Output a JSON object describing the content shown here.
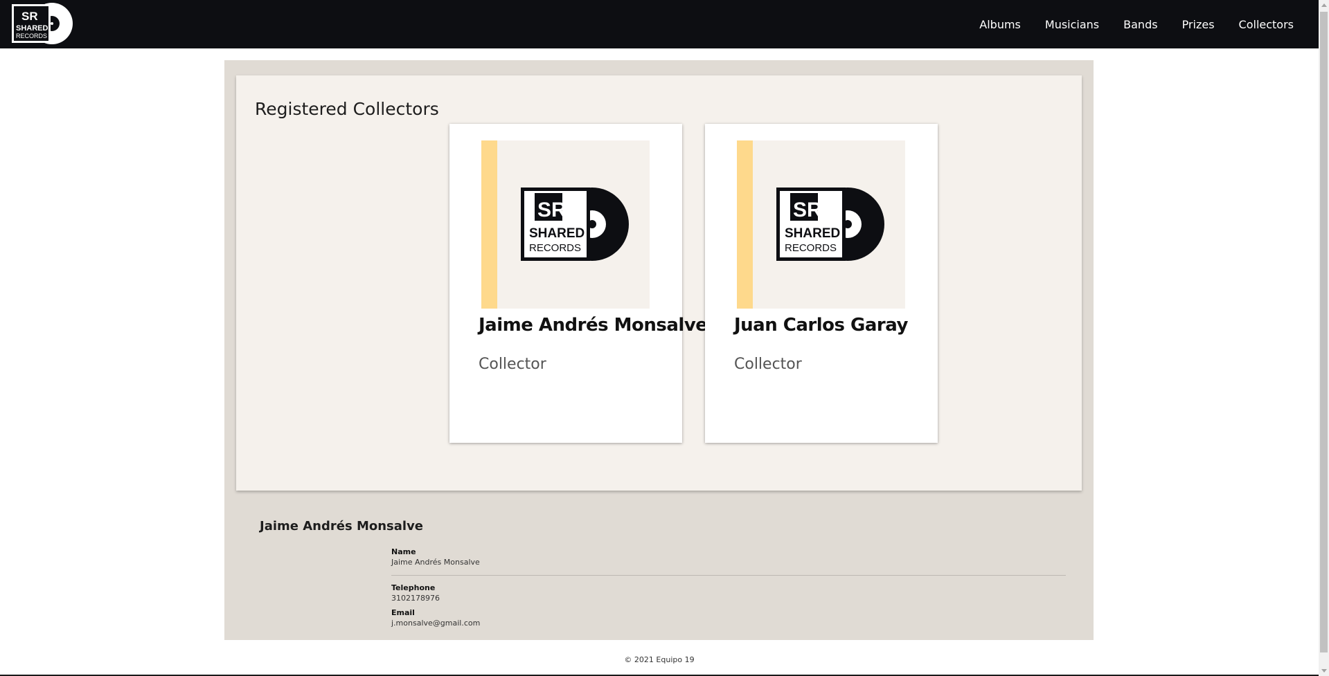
{
  "header": {
    "logo": {
      "line1": "SR",
      "line2": "SHARED",
      "line3": "RECORDS"
    },
    "nav": [
      {
        "label": "Albums"
      },
      {
        "label": "Musicians"
      },
      {
        "label": "Bands"
      },
      {
        "label": "Prizes"
      },
      {
        "label": "Collectors"
      }
    ]
  },
  "collectors": {
    "title": "Registered Collectors",
    "cards": [
      {
        "name": "Jaime Andrés Monsalve",
        "role": "Collector"
      },
      {
        "name": "Juan Carlos Garay",
        "role": "Collector"
      }
    ]
  },
  "detail": {
    "title": "Jaime Andrés Monsalve",
    "name_label": "Name",
    "name_value": "Jaime Andrés Monsalve",
    "telephone_label": "Telephone",
    "telephone_value": "3102178976",
    "email_label": "Email",
    "email_value": "j.monsalve@gmail.com"
  },
  "footer": {
    "text": "© 2021 Equipo 19"
  },
  "colors": {
    "navbar": "#0d0e12",
    "accent_stripe": "#fed98c",
    "panel": "#f5f1ec",
    "main_bg": "#e0dbd4"
  }
}
